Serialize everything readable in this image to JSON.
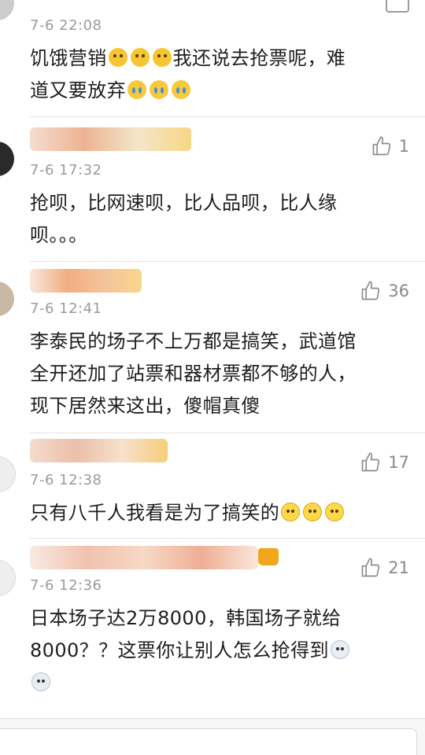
{
  "comments": [
    {
      "timestamp": "7-6 22:08",
      "likes": "",
      "lines": [
        "饥饿营销",
        "我还说去抢票呢，难",
        "道又要放弃"
      ]
    },
    {
      "timestamp": "7-6 17:32",
      "likes": "1",
      "lines": [
        "抢呗，比网速呗，比人品呗，比人缘",
        "呗。。。"
      ]
    },
    {
      "timestamp": "7-6 12:41",
      "likes": "36",
      "lines": [
        "李泰民的场子不上万都是搞笑，武道馆",
        "全开还加了站票和器材票都不够的人，",
        "现下居然来这出，傻帽真傻"
      ]
    },
    {
      "timestamp": "7-6 12:38",
      "likes": "17",
      "lines": [
        "只有八千人我看是为了搞笑的"
      ]
    },
    {
      "timestamp": "7-6 12:36",
      "likes": "21",
      "lines": [
        "日本场子达2万8000，韩国场子就给",
        "8000？？这票你让别人怎么抢得到"
      ]
    }
  ],
  "icons": {
    "like": "thumbs-up-icon",
    "emoji_laugh": "laughing-tears-emoji",
    "emoji_cry": "crying-emoji",
    "emoji_smile": "smile-emoji",
    "emoji_dog": "husky-emoji",
    "crown": "crown-badge-icon"
  },
  "colors": {
    "text": "#1e1e1e",
    "meta": "#9b9b9b",
    "like": "#8a8a8a",
    "divider": "#e4e4e4"
  }
}
